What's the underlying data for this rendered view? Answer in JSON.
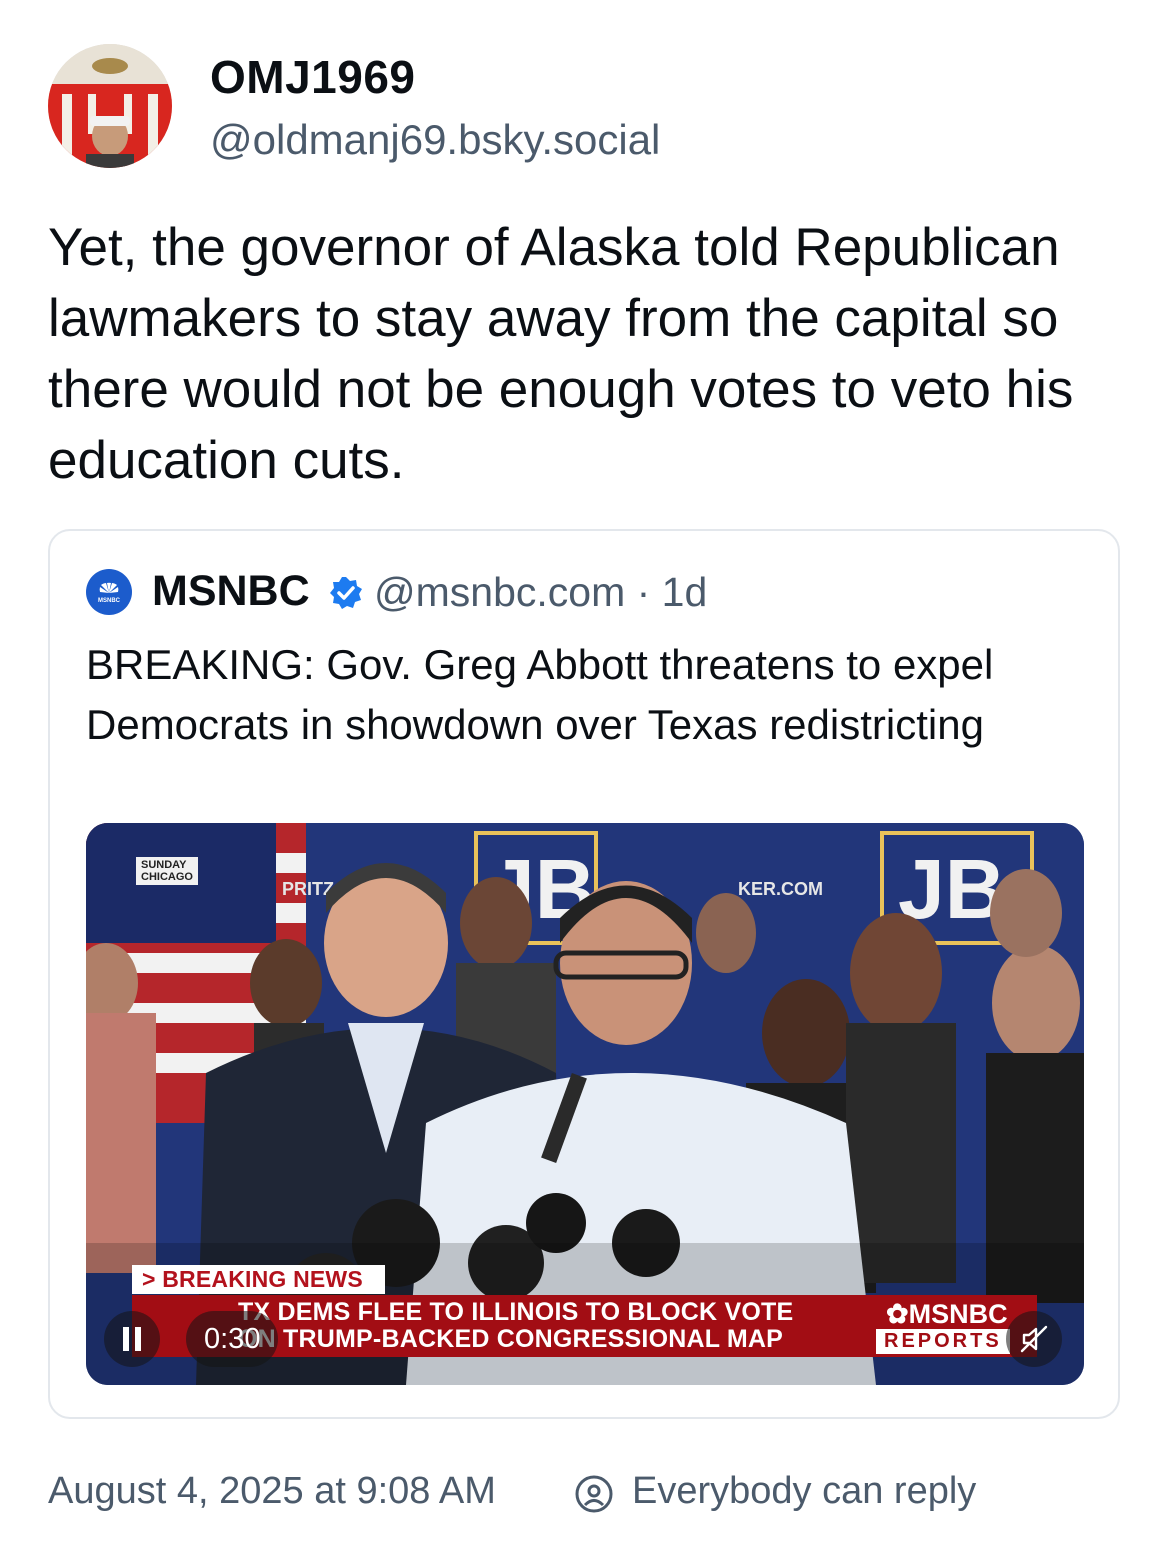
{
  "post": {
    "display_name": "OMJ1969",
    "handle": "@oldmanj69.bsky.social",
    "text": "Yet, the governor of Alaska told Republican lawmakers to stay away from the capital so there would not be enough votes to veto his education cuts.",
    "date": "August 4, 2025 at 9:08 AM",
    "reply_setting": "Everybody can reply"
  },
  "quote": {
    "name": "MSNBC",
    "handle_time": "@msnbc.com · 1d",
    "text": "BREAKING: Gov. Greg Abbott threatens to expel Democrats in showdown over Texas redistricting",
    "avatar_label": "MSNBC"
  },
  "video": {
    "bug_line1": "SUNDAY",
    "bug_line2": "CHICAGO",
    "breaking_label": "> BREAKING NEWS",
    "headline_line1": "TX DEMS FLEE TO ILLINOIS TO BLOCK VOTE",
    "headline_line2": "ON TRUMP-BACKED CONGRESSIONAL MAP",
    "logo": "MSNBC",
    "logo_sub": "REPORTS",
    "backdrop_text_left": "PRITZ",
    "backdrop_text_right": "KER.COM",
    "backdrop_logo": "JB",
    "elapsed": "0:30"
  },
  "colors": {
    "accent_verified": "#1d7bf0",
    "breaking_red": "#a20d14",
    "muted_text": "#4b5a6b"
  }
}
